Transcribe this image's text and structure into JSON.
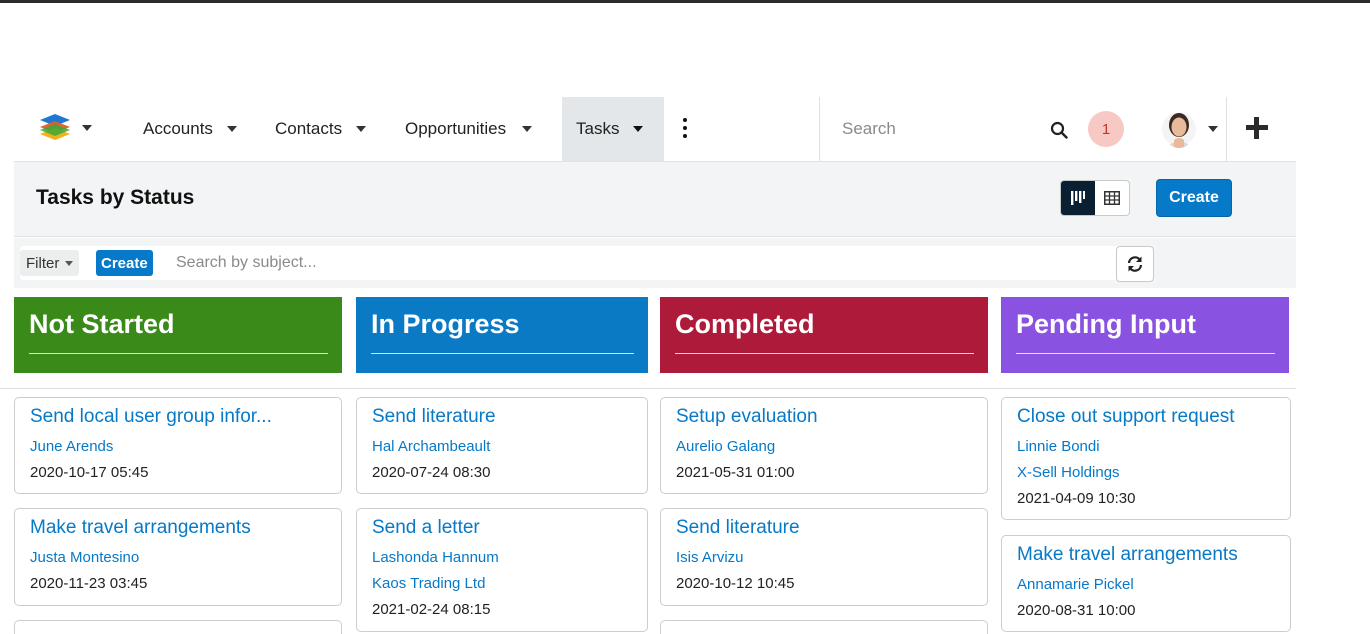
{
  "nav": {
    "menu": [
      {
        "label": "Accounts"
      },
      {
        "label": "Contacts"
      },
      {
        "label": "Opportunities"
      },
      {
        "label": "Tasks"
      }
    ],
    "search_placeholder": "Search",
    "notification_count": "1"
  },
  "header": {
    "title": "Tasks by Status",
    "create_label": "Create"
  },
  "filter": {
    "filter_label": "Filter",
    "create_label": "Create",
    "search_placeholder": "Search by subject..."
  },
  "columns": [
    {
      "title": "Not Started",
      "color": "#398a18",
      "cards": [
        {
          "subject": "Send local user group infor...",
          "contact": "June Arends",
          "date": "2020-10-17 05:45"
        },
        {
          "subject": "Make travel arrangements",
          "contact": "Justa Montesino",
          "date": "2020-11-23 03:45"
        }
      ]
    },
    {
      "title": "In Progress",
      "color": "#0b7ac5",
      "cards": [
        {
          "subject": "Send literature",
          "contact": "Hal Archambeault",
          "date": "2020-07-24 08:30"
        },
        {
          "subject": "Send a letter",
          "contact": "Lashonda Hannum",
          "account": "Kaos Trading Ltd",
          "date": "2021-02-24 08:15"
        }
      ]
    },
    {
      "title": "Completed",
      "color": "#ae1a3a",
      "cards": [
        {
          "subject": "Setup evaluation",
          "contact": "Aurelio Galang",
          "date": "2021-05-31 01:00"
        },
        {
          "subject": "Send literature",
          "contact": "Isis Arvizu",
          "date": "2020-10-12 10:45"
        }
      ]
    },
    {
      "title": "Pending Input",
      "color": "#8a52e0",
      "cards": [
        {
          "subject": "Close out support request",
          "contact": "Linnie Bondi",
          "account": "X-Sell Holdings",
          "date": "2021-04-09 10:30"
        },
        {
          "subject": "Make travel arrangements",
          "contact": "Annamarie Pickel",
          "date": "2020-08-31 10:00"
        }
      ]
    }
  ],
  "icons": {
    "logo": "stacked-layers-logo-icon",
    "search": "magnifier-icon",
    "more": "vertical-ellipsis-icon",
    "kanban": "kanban-view-icon",
    "table": "table-view-icon",
    "refresh": "refresh-icon",
    "quick_create": "plus-icon"
  }
}
